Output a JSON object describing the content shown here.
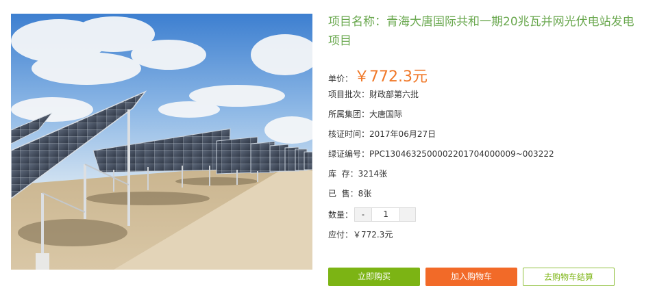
{
  "product": {
    "title": "项目名称：青海大唐国际共和一期20兆瓦并网光伏电站发电项目",
    "price_label": "单价：",
    "price": "￥772.3元",
    "details": [
      {
        "label": "项目批次：",
        "value": "财政部第六批"
      },
      {
        "label": "所属集团：",
        "value": "大唐国际"
      },
      {
        "label": "核证时间：",
        "value": "2017年06月27日"
      },
      {
        "label": "绿证编号：",
        "value": "PPC1304632500002201704000009~003222"
      },
      {
        "label": "库  存：",
        "value": "3214张"
      },
      {
        "label": "已  售：",
        "value": "8张"
      }
    ],
    "quantity_label": "数量：",
    "quantity_minus": "-",
    "quantity_value": "1",
    "payable_label": "应付：",
    "payable_value": "￥772.3元"
  },
  "actions": {
    "buy_now": "立即购买",
    "add_to_cart": "加入购物车",
    "checkout": "去购物车结算"
  },
  "colors": {
    "title_green": "#6aa84f",
    "price_orange": "#f07828",
    "buy_green": "#7cb414",
    "cart_orange": "#f26a28"
  }
}
